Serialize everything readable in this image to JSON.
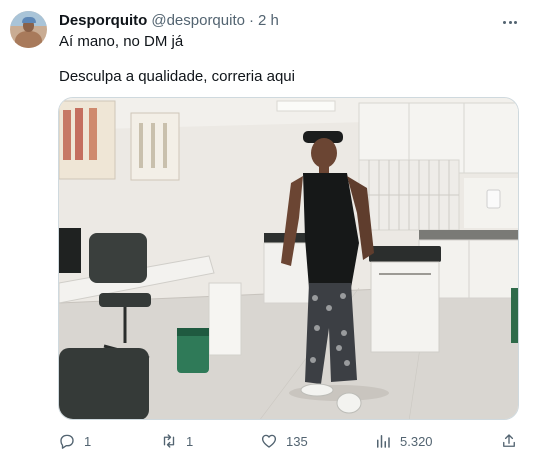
{
  "tweet": {
    "author_name": "Desporquito",
    "handle": "@desporquito",
    "separator": "·",
    "time": "2 h",
    "text_line1": "Aí mano, no DM já",
    "text_line2": "Desculpa a qualidade, correria aqui"
  },
  "media": {
    "description_icon": "photo"
  },
  "actions": {
    "replies": "1",
    "reposts": "1",
    "likes": "135",
    "views": "5.320"
  },
  "colors": {
    "text": "#0f1419",
    "secondary": "#536471",
    "border": "#cfd9de"
  }
}
